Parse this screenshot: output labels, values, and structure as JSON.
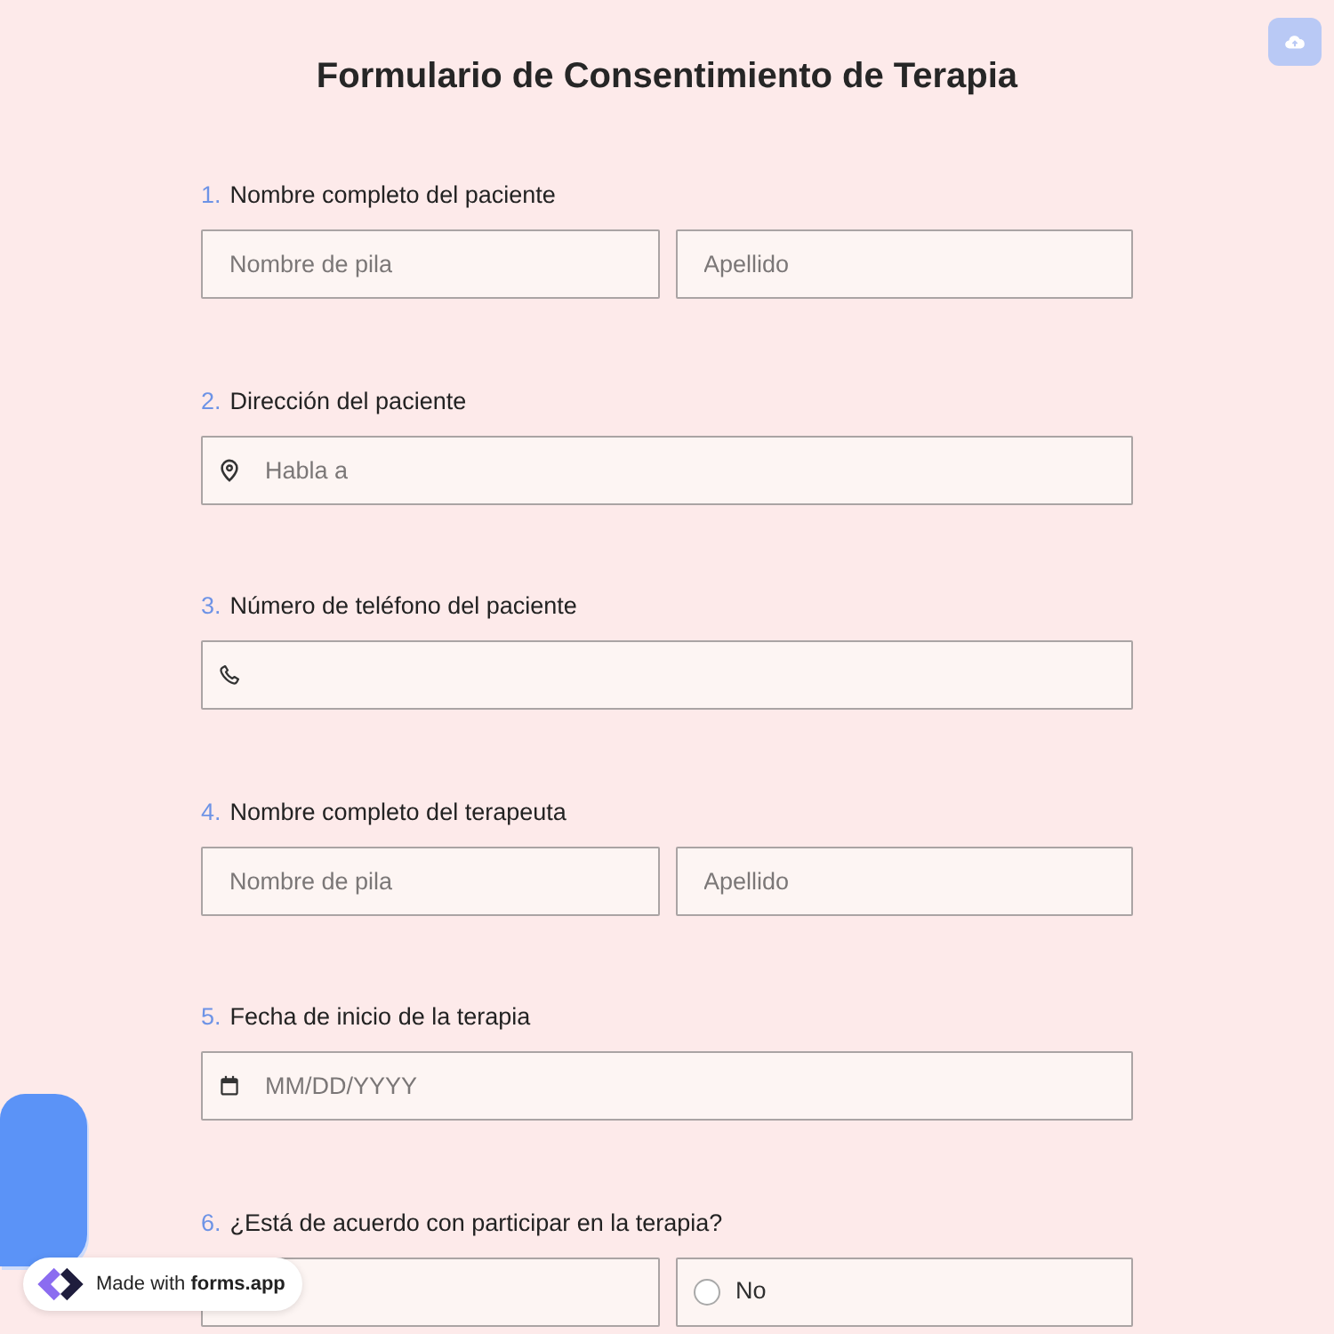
{
  "form": {
    "title": "Formulario de Consentimiento de Terapia"
  },
  "questions": [
    {
      "number": "1.",
      "label": "Nombre completo del paciente",
      "kind": "name",
      "fields": [
        {
          "placeholder": "Nombre de pila"
        },
        {
          "placeholder": "Apellido"
        }
      ]
    },
    {
      "number": "2.",
      "label": "Dirección del paciente",
      "kind": "address",
      "placeholder": "Habla a"
    },
    {
      "number": "3.",
      "label": "Número de teléfono del paciente",
      "kind": "phone"
    },
    {
      "number": "4.",
      "label": "Nombre completo del terapeuta",
      "kind": "name",
      "fields": [
        {
          "placeholder": "Nombre de pila"
        },
        {
          "placeholder": "Apellido"
        }
      ]
    },
    {
      "number": "5.",
      "label": "Fecha de inicio de la terapia",
      "kind": "date",
      "placeholder": "MM/DD/YYYY"
    },
    {
      "number": "6.",
      "label": "¿Está de acuerdo con participar en la terapia?",
      "kind": "choice",
      "options": [
        {
          "kind": "covered"
        },
        {
          "kind": "radio",
          "label": "No",
          "selected": false
        }
      ]
    }
  ],
  "badge": {
    "text": "Made with **forms.app**"
  }
}
